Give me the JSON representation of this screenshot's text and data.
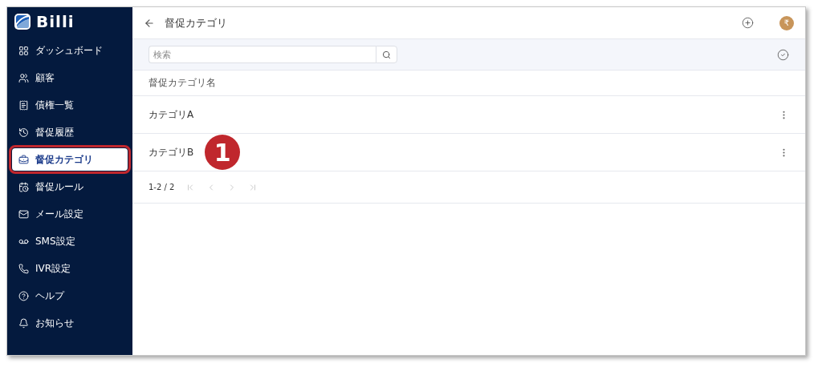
{
  "sidebar": {
    "logo": "Billi",
    "items": [
      {
        "label": "ダッシュボード",
        "selected": false
      },
      {
        "label": "顧客",
        "selected": false
      },
      {
        "label": "債権一覧",
        "selected": false
      },
      {
        "label": "督促履歴",
        "selected": false
      },
      {
        "label": "督促カテゴリ",
        "selected": true
      },
      {
        "label": "督促ルール",
        "selected": false
      },
      {
        "label": "メール設定",
        "selected": false
      },
      {
        "label": "SMS設定",
        "selected": false
      },
      {
        "label": "IVR設定",
        "selected": false
      },
      {
        "label": "ヘルプ",
        "selected": false
      },
      {
        "label": "お知らせ",
        "selected": false
      }
    ]
  },
  "header": {
    "title": "督促カテゴリ",
    "avatar": "₹"
  },
  "search": {
    "placeholder": "検索"
  },
  "table": {
    "columns": [
      "督促カテゴリ名"
    ],
    "rows": [
      {
        "name": "カテゴリA"
      },
      {
        "name": "カテゴリB"
      }
    ]
  },
  "pagination": {
    "range": "1-2 / 2"
  },
  "annotation": {
    "label": "1"
  }
}
